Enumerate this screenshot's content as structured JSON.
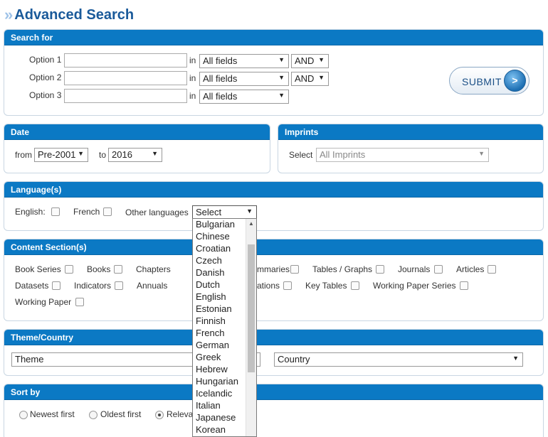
{
  "page": {
    "title": "Advanced Search"
  },
  "search_for": {
    "heading": "Search for",
    "rows": [
      {
        "label": "Option 1",
        "in": "in",
        "field": "All fields",
        "operator": "AND"
      },
      {
        "label": "Option 2",
        "in": "in",
        "field": "All fields",
        "operator": "AND"
      },
      {
        "label": "Option 3",
        "in": "in",
        "field": "All fields"
      }
    ],
    "submit_label": "SUBMIT"
  },
  "date": {
    "heading": "Date",
    "from_label": "from",
    "from_value": "Pre-2001",
    "to_label": "to",
    "to_value": "2016"
  },
  "imprints": {
    "heading": "Imprints",
    "select_label": "Select",
    "value": "All Imprints"
  },
  "languages": {
    "heading": "Language(s)",
    "english": "English:",
    "french": "French",
    "other_label": "Other languages",
    "other_value": "Select",
    "options": [
      "Bulgarian",
      "Chinese",
      "Croatian",
      "Czech",
      "Danish",
      "Dutch",
      "English",
      "Estonian",
      "Finnish",
      "French",
      "German",
      "Greek",
      "Hebrew",
      "Hungarian",
      "Icelandic",
      "Italian",
      "Japanese",
      "Korean"
    ]
  },
  "content_sections": {
    "heading": "Content Section(s)",
    "row1": [
      "Book Series",
      "Books",
      "Chapters",
      "mmaries",
      "Tables / Graphs",
      "Journals",
      "Articles"
    ],
    "row2": [
      "Datasets",
      "Indicators",
      "Annuals",
      "ations",
      "Key Tables",
      "Working Paper Series"
    ],
    "row3": [
      "Working Paper"
    ]
  },
  "theme_country": {
    "heading": "Theme/Country",
    "theme_value": "Theme",
    "country_value": "Country"
  },
  "sort_by": {
    "heading": "Sort by",
    "options": [
      "Newest first",
      "Oldest first",
      "Releva"
    ]
  },
  "icons": {
    "arrow": "▼",
    "up": "▲",
    "submit_icon": ">"
  }
}
